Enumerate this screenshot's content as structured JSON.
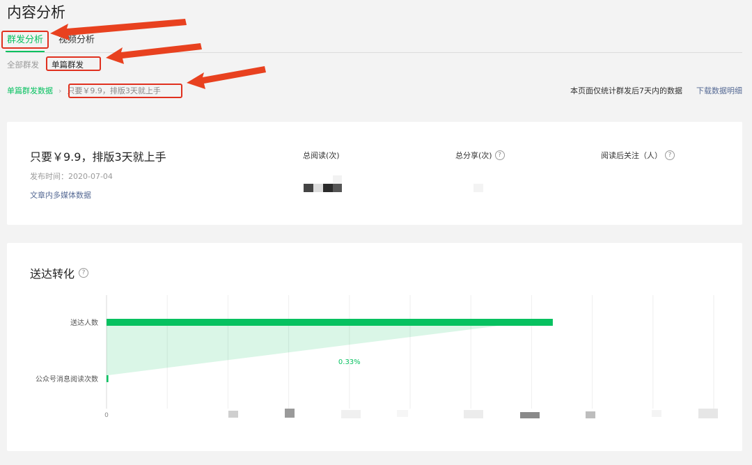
{
  "page": {
    "title": "内容分析"
  },
  "tabs": [
    {
      "label": "群发分析",
      "active": true
    },
    {
      "label": "视频分析",
      "active": false
    }
  ],
  "subtabs": [
    {
      "label": "全部群发",
      "active": false
    },
    {
      "label": "单篇群发",
      "active": true
    }
  ],
  "breadcrumb": {
    "parent": "单篇群发数据",
    "separator": "›",
    "current": "只要￥9.9，排版3天就上手"
  },
  "notice": "本页面仅统计群发后7天内的数据",
  "download_label": "下载数据明细",
  "summary": {
    "article_title": "只要￥9.9，排版3天就上手",
    "publish_time": "发布时间：2020-07-04",
    "media_link": "文章内多媒体数据",
    "metrics": [
      {
        "label": "总阅读(次)",
        "help": false
      },
      {
        "label": "总分享(次)",
        "help": true
      },
      {
        "label": "阅读后关注（人）",
        "help": true
      }
    ]
  },
  "conversion": {
    "title": "送达转化",
    "help_glyph": "?"
  },
  "colors": {
    "accent": "#07c160",
    "link": "#576b95",
    "annotation": "#e0301e"
  },
  "chart_data": {
    "type": "bar",
    "orientation": "horizontal",
    "categories": [
      "送达人数",
      "公众号消息阅读次数"
    ],
    "values_fraction_of_axis": [
      0.735,
      0.003
    ],
    "conversion_label": "0.33%",
    "x_tick_first_label": "0",
    "grid": true,
    "x_tick_labels_obscured": true
  }
}
